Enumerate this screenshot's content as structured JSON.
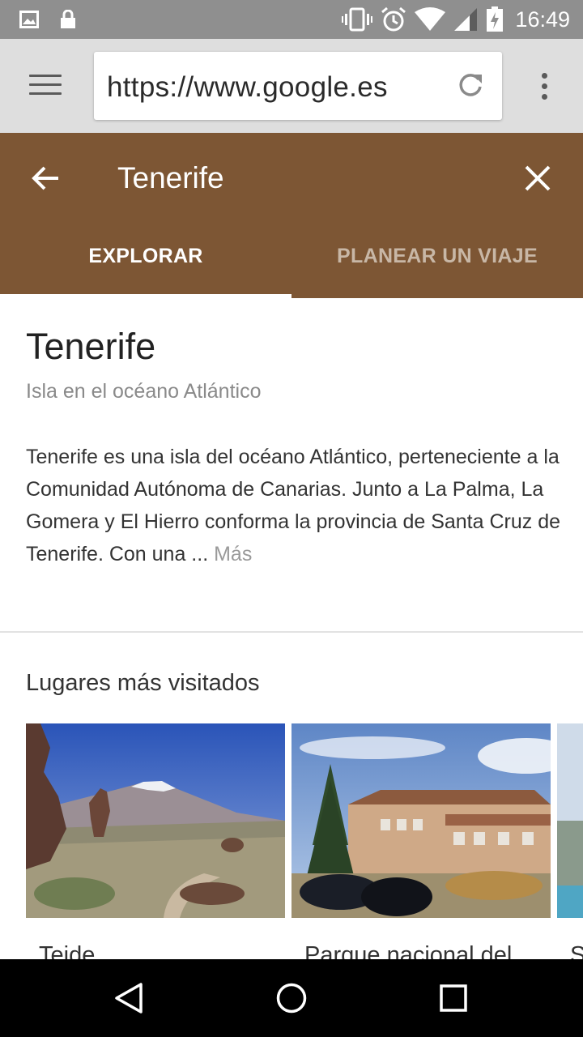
{
  "status_bar": {
    "time": "16:49",
    "icons": [
      "image-icon",
      "lock-icon",
      "vibrate-icon",
      "alarm-icon",
      "wifi-icon",
      "signal-icon",
      "battery-charging-icon"
    ]
  },
  "browser": {
    "url": "https://www.google.es",
    "icons": [
      "menu-icon",
      "reload-icon",
      "overflow-menu-icon"
    ]
  },
  "search_header": {
    "query": "Tenerife",
    "tabs": [
      {
        "label": "EXPLORAR",
        "selected": true
      },
      {
        "label": "PLANEAR UN VIAJE",
        "selected": false
      }
    ],
    "colors": {
      "background": "#7d5634",
      "selected_tab": "#ffffff",
      "unselected_tab": "#c8b7a6"
    }
  },
  "entity": {
    "title": "Tenerife",
    "subtitle": "Isla en el océano Atlántico",
    "description": "Tenerife es una isla del océano Atlántico, perteneciente a la Comunidad Autónoma de Canarias. Junto a La Palma, La Gomera y El Hierro conforma la provincia de Santa Cruz de Tenerife. Con una ...",
    "more_label": "Más"
  },
  "places": {
    "title": "Lugares más visitados",
    "items": [
      {
        "name": "Teide"
      },
      {
        "name": "Parque nacional del"
      },
      {
        "name": "S"
      }
    ]
  },
  "nav_bar": {
    "icons": [
      "back-triangle-icon",
      "home-circle-icon",
      "recents-square-icon"
    ]
  }
}
